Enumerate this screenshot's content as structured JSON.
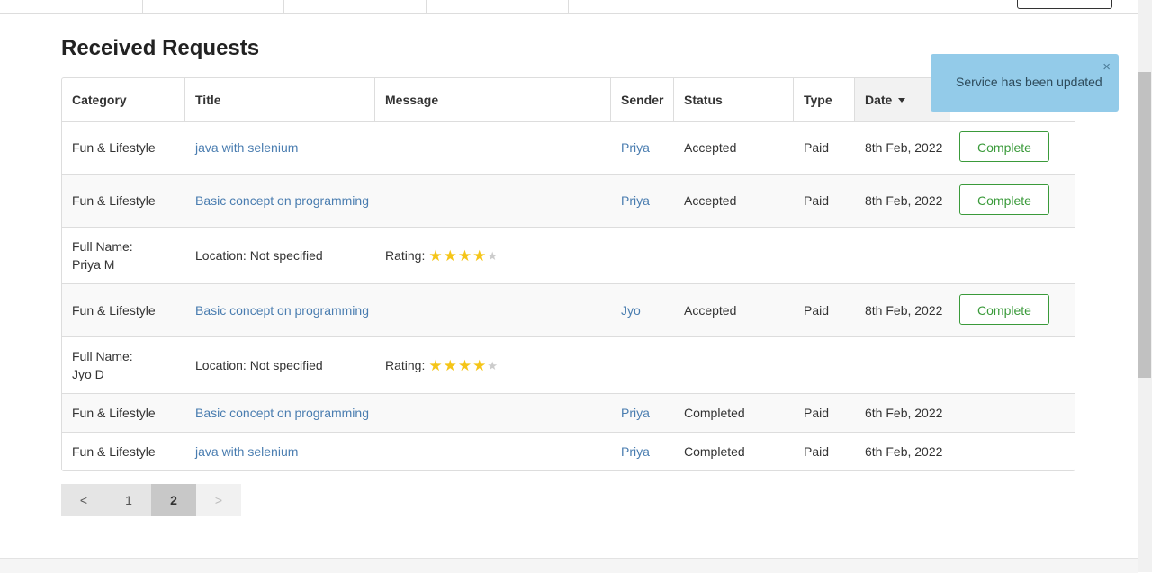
{
  "page": {
    "title": "Received Requests"
  },
  "columns": {
    "category": "Category",
    "title": "Title",
    "message": "Message",
    "sender": "Sender",
    "status": "Status",
    "type": "Type",
    "date": "Date"
  },
  "rows": [
    {
      "category": "Fun & Lifestyle",
      "title": "java with selenium",
      "message": "",
      "sender": "Priya",
      "status": "Accepted",
      "type": "Paid",
      "date": "8th Feb, 2022",
      "action": "Complete"
    },
    {
      "category": "Fun & Lifestyle",
      "title": "Basic concept on programming",
      "message": "",
      "sender": "Priya",
      "status": "Accepted",
      "type": "Paid",
      "date": "8th Feb, 2022",
      "action": "Complete"
    },
    {
      "full_name_label": "Full Name:",
      "full_name": "Priya M",
      "location": "Location: Not specified",
      "rating_label": "Rating:",
      "rating": 4
    },
    {
      "category": "Fun & Lifestyle",
      "title": "Basic concept on programming",
      "message": "",
      "sender": "Jyo",
      "status": "Accepted",
      "type": "Paid",
      "date": "8th Feb, 2022",
      "action": "Complete"
    },
    {
      "full_name_label": "Full Name:",
      "full_name": "Jyo D",
      "location": "Location: Not specified",
      "rating_label": "Rating:",
      "rating": 4
    },
    {
      "category": "Fun & Lifestyle",
      "title": "Basic concept on programming",
      "message": "",
      "sender": "Priya",
      "status": "Completed",
      "type": "Paid",
      "date": "6th Feb, 2022"
    },
    {
      "category": "Fun & Lifestyle",
      "title": "java with selenium",
      "message": "",
      "sender": "Priya",
      "status": "Completed",
      "type": "Paid",
      "date": "6th Feb, 2022"
    }
  ],
  "pagination": {
    "prev": "<",
    "pages": [
      "1",
      "2"
    ],
    "current": "2",
    "next": ">"
  },
  "toast": {
    "message": "Service has been updated",
    "close": "×"
  },
  "icons": {
    "sort": "caret-down-icon",
    "star": "star-icon",
    "close": "close-icon"
  },
  "colors": {
    "link": "#4a7db0",
    "success": "#3a9a3a",
    "toast_bg": "#93cbe9",
    "star": "#f5c518"
  }
}
